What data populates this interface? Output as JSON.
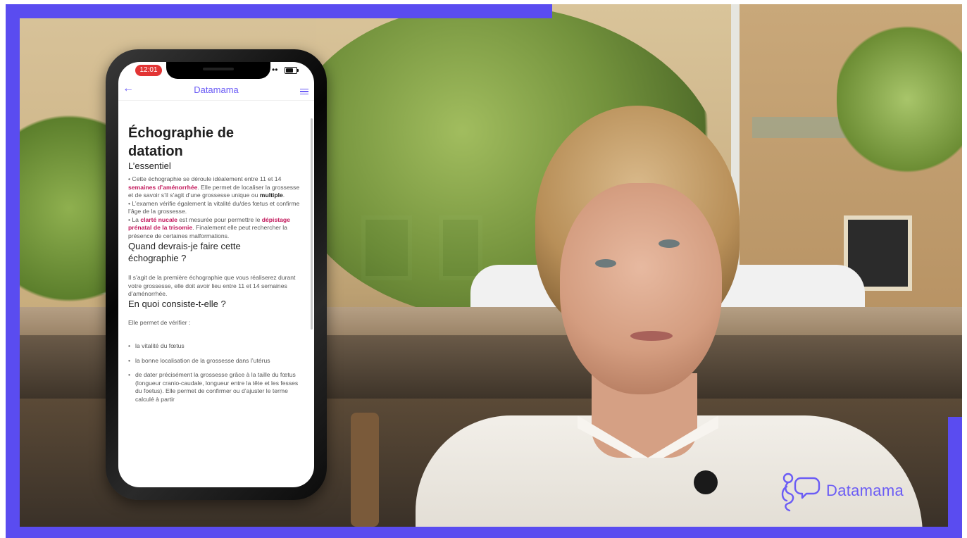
{
  "colors": {
    "frame_accent": "#5a4cf0",
    "brand": "#6b5cf5",
    "highlight": "#c2185b",
    "status_pill": "#e23434"
  },
  "phone": {
    "status_time": "12:01",
    "nav": {
      "title": "Datamama",
      "back_icon": "arrow-left-icon",
      "menu_icon": "hamburger-menu-icon"
    },
    "page_title_line1": "Échographie de",
    "page_title_line2": "datation",
    "sections": {
      "essentiel": {
        "title": "L’essentiel",
        "p1_pre": "• Cette échographie se déroule idéalement entre 11 et 14 ",
        "p1_hl1": "semaines d’aménorrhée",
        "p1_mid": ". Elle permet de localiser la grossesse et de savoir s’il s’agit d’une grossesse unique ou ",
        "p1_hl2": "multiple",
        "p1_end": ".",
        "p2": "• L’examen vérifie également la vitalité du/des fœtus et confirme l’âge de la grossesse.",
        "p3_pre": "• La ",
        "p3_hl1": "clarté nucale",
        "p3_mid": " est mesurée pour permettre le ",
        "p3_hl2": "dépistage prénatal de la trisomie",
        "p3_end": ". Finalement elle peut rechercher la présence de certaines malformations."
      },
      "quand": {
        "title_line1": "Quand devrais-je faire cette",
        "title_line2": "échographie ?",
        "body": "Il s’agit de la première échographie que vous réaliserez durant votre grossesse, elle doit avoir lieu entre 11 et 14 semaines d’aménorrhée."
      },
      "en_quoi": {
        "title": "En quoi consiste-t-elle ?",
        "intro": "Elle permet de vérifier :",
        "items": [
          "la vitalité du fœtus",
          "la bonne localisation de la grossesse dans l’utérus",
          "de dater précisément la grossesse grâce à la taille du fœtus (longueur cranio-caudale, longueur entre la tête et les fesses du foetus). Elle permet de confirmer ou d’ajuster le terme calculé à partir"
        ]
      }
    }
  },
  "watermark": {
    "brand_name": "Datamama",
    "logo_icon": "pregnant-speech-bubble-logo-icon"
  }
}
